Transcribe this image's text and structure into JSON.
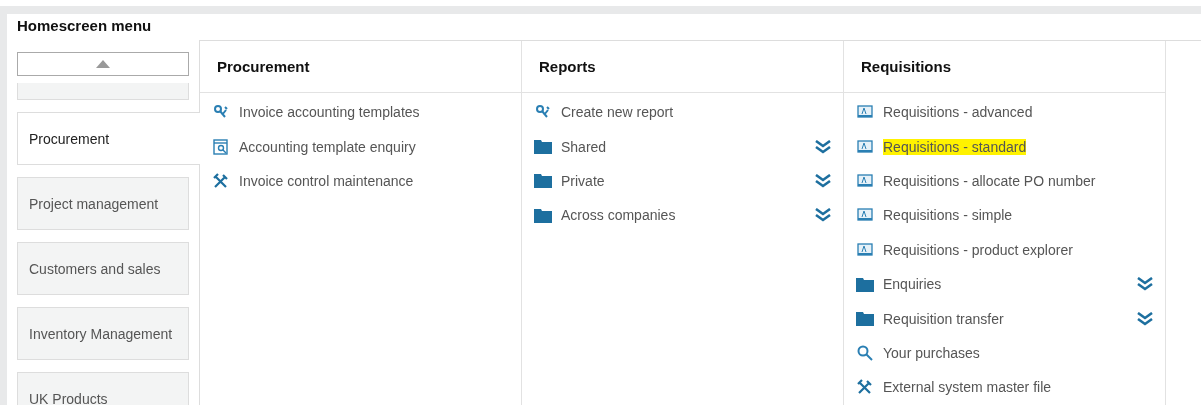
{
  "title": "Homescreen menu",
  "sidebar": {
    "items": [
      {
        "label": "Procurement",
        "selected": true
      },
      {
        "label": "Project management",
        "selected": false
      },
      {
        "label": "Customers and sales",
        "selected": false
      },
      {
        "label": "Inventory Management",
        "selected": false
      },
      {
        "label": "UK Products",
        "selected": false
      }
    ]
  },
  "columns": [
    {
      "title": "Procurement",
      "items": [
        {
          "kind": "template",
          "label": "Invoice accounting templates"
        },
        {
          "kind": "enquiry",
          "label": "Accounting template enquiry"
        },
        {
          "kind": "tools",
          "label": "Invoice control maintenance"
        }
      ]
    },
    {
      "title": "Reports",
      "items": [
        {
          "kind": "template",
          "label": "Create new report"
        },
        {
          "kind": "folder",
          "label": "Shared"
        },
        {
          "kind": "folder",
          "label": "Private"
        },
        {
          "kind": "folder",
          "label": "Across companies"
        }
      ]
    },
    {
      "title": "Requisitions",
      "items": [
        {
          "kind": "form",
          "label": "Requisitions - advanced",
          "highlighted": false
        },
        {
          "kind": "form",
          "label": "Requisitions - standard",
          "highlighted": true
        },
        {
          "kind": "form",
          "label": "Requisitions - allocate PO number",
          "highlighted": false
        },
        {
          "kind": "form",
          "label": "Requisitions - simple",
          "highlighted": false
        },
        {
          "kind": "form",
          "label": "Requisitions - product explorer",
          "highlighted": false
        },
        {
          "kind": "folder",
          "label": "Enquiries"
        },
        {
          "kind": "folder",
          "label": "Requisition transfer"
        },
        {
          "kind": "search",
          "label": "Your purchases"
        },
        {
          "kind": "tools",
          "label": "External system master file"
        }
      ]
    }
  ]
}
